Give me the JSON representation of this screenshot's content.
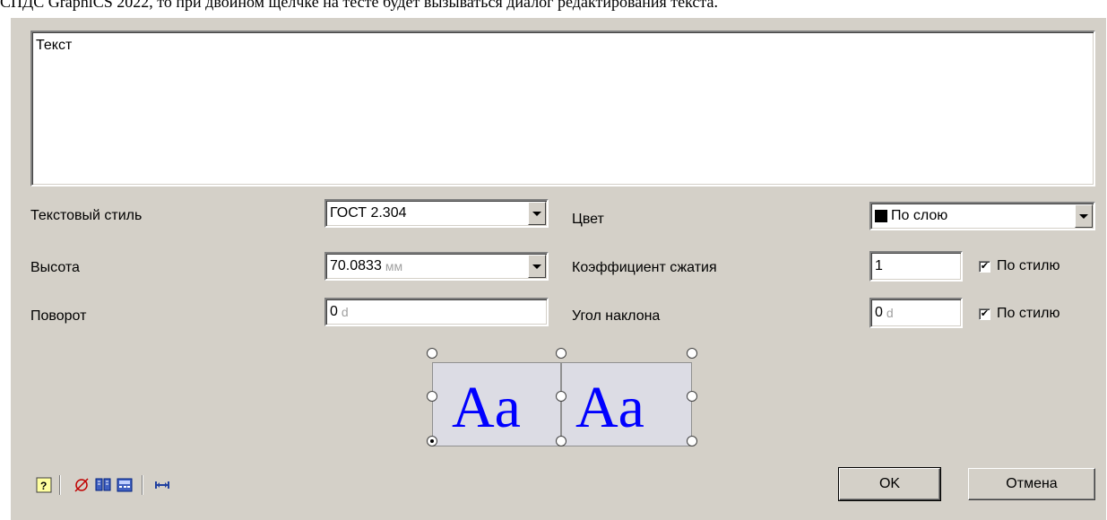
{
  "caption": "СПДС GraphiCS 2022, то при двойном щелчке на тесте будет вызываться диалог редактирования текста.",
  "text_content": "Текст",
  "labels": {
    "text_style": "Текстовый стиль",
    "height": "Высота",
    "rotation": "Поворот",
    "color": "Цвет",
    "compression": "Коэффициент сжатия",
    "slant": "Угол наклона"
  },
  "fields": {
    "text_style": "ГОСТ 2.304",
    "height_value": "70.0833",
    "height_unit": "мм",
    "rotation_value": "0",
    "rotation_unit": "d",
    "color": "По слою",
    "compression": "1",
    "slant_value": "0",
    "slant_unit": "d"
  },
  "checkboxes": {
    "compression_by_style": {
      "label": "По стилю",
      "checked": true
    },
    "slant_by_style": {
      "label": "По стилю",
      "checked": true
    }
  },
  "preview": {
    "sample": "Aa",
    "color": "#0000ff"
  },
  "toolbar": [
    "help-icon",
    "diameter-icon",
    "book-icon",
    "calculator-icon",
    "width-icon"
  ],
  "buttons": {
    "ok": "OK",
    "cancel": "Отмена"
  },
  "colors": {
    "dialog_bg": "#d4d0c8",
    "preview_fill": "#dcdce4",
    "swatch": "#000000"
  }
}
